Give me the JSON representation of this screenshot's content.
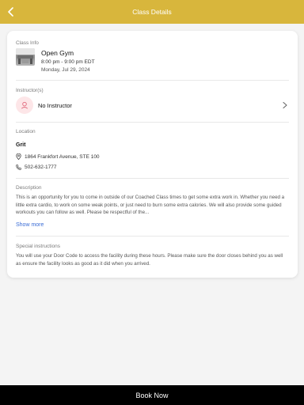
{
  "header": {
    "title": "Class Details",
    "back_icon": "chevron-left-icon",
    "color": "#d8b63c"
  },
  "class_info": {
    "label": "Class Info",
    "name": "Open Gym",
    "time": "8:00 pm - 9:00 pm EDT",
    "date": "Monday, Jul 29, 2024"
  },
  "instructors": {
    "label": "Instructor(s)",
    "name": "No Instructor",
    "avatar_icon": "person-icon",
    "chevron_icon": "chevron-right-icon"
  },
  "location": {
    "label": "Location",
    "name": "Grit",
    "address": "1864 Frankfort Avenue, STE 100",
    "phone": "502-632-1777",
    "address_icon": "map-pin-icon",
    "phone_icon": "phone-icon"
  },
  "description": {
    "label": "Description",
    "text": "This is an opportunity for you to come in outside of our Coached Class times to get some extra work in. Whether you need a little extra cardio, to work on some weak points, or just need to burn some extra calories.  We will also provide some guided workouts you can follow as well.   Please be respectful of the...",
    "show_more": "Show more",
    "link_color": "#3b6dd6"
  },
  "special_instructions": {
    "label": "Special instructions",
    "text": "You will use your Door Code to access the facility during these hours.  Please make sure the door closes behind you as well as ensure the facility looks as good as it did when you arrived."
  },
  "footer": {
    "book_label": "Book Now"
  }
}
